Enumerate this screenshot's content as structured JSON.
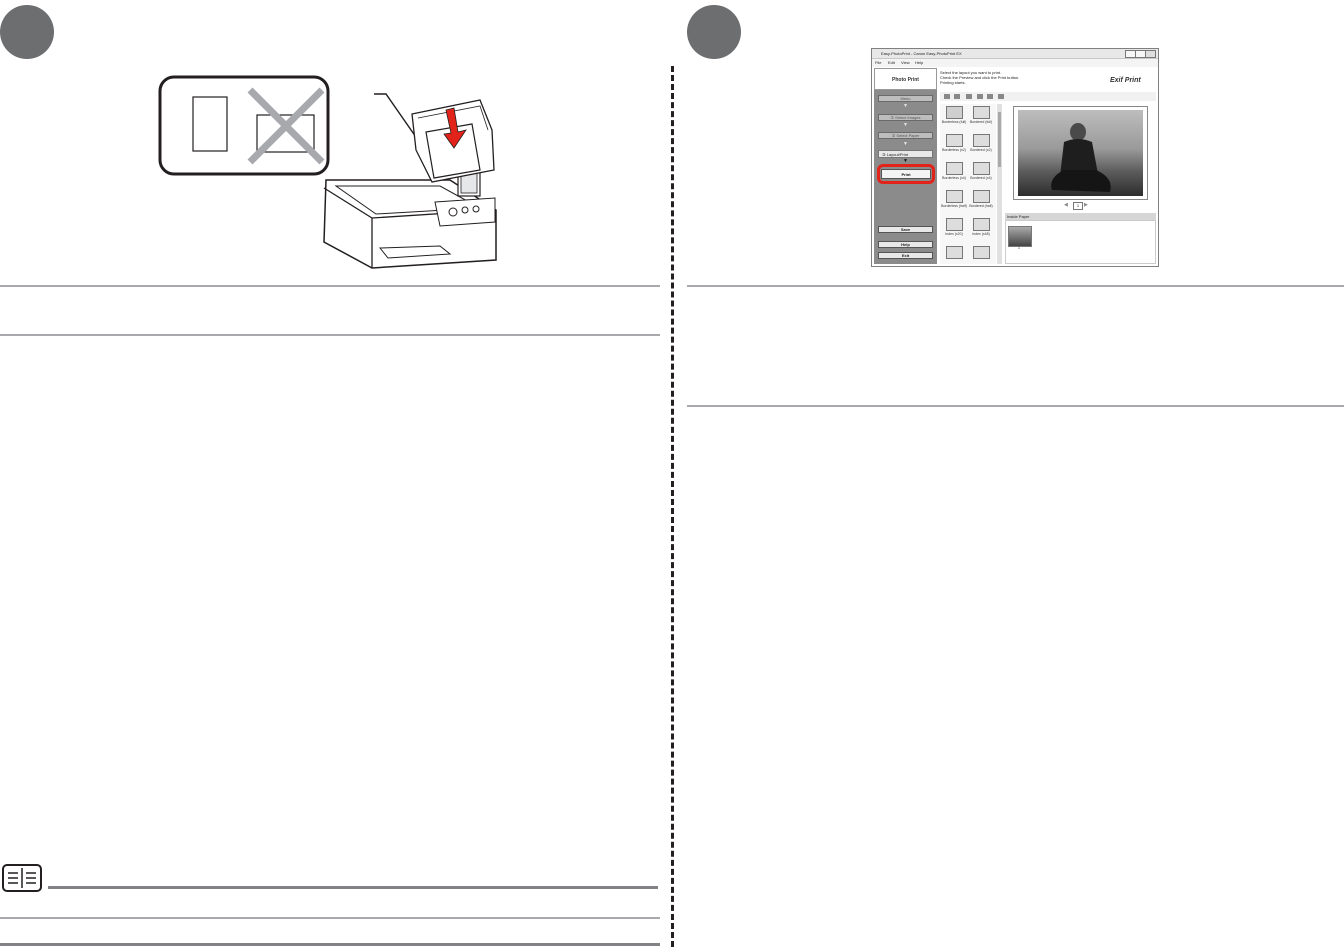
{
  "screenshot": {
    "window_title": "Easy-PhotoPrint - Canon Easy-PhotoPrint EX",
    "menu": [
      "File",
      "Edit",
      "View",
      "Help"
    ],
    "sidebar": {
      "heading": "Photo Print",
      "menu_button": "Menu",
      "step1": "① Select Images",
      "step2": "② Select Paper",
      "step3": "③ Layout/Print",
      "print_button": "Print",
      "save_button": "Save",
      "help_button": "Help",
      "exit_button": "Exit"
    },
    "instructions": [
      "Select the layout you want to print.",
      "Check the Preview and click the Print button.",
      "Printing starts."
    ],
    "logo_text": "Exif Print",
    "layouts": [
      {
        "label": "Borderless (full)"
      },
      {
        "label": "Bordered (full)"
      },
      {
        "label": "Borderless (x2)"
      },
      {
        "label": "Bordered (x2)"
      },
      {
        "label": "Borderless (x4)"
      },
      {
        "label": "Bordered (x4)"
      },
      {
        "label": "Borderless (half)"
      },
      {
        "label": "Bordered (half)"
      },
      {
        "label": "Index (x20)"
      },
      {
        "label": "Index (x48)"
      }
    ],
    "page_number": "1",
    "inside_paper_label": "Inside Paper",
    "thumbnail_number": "1"
  }
}
